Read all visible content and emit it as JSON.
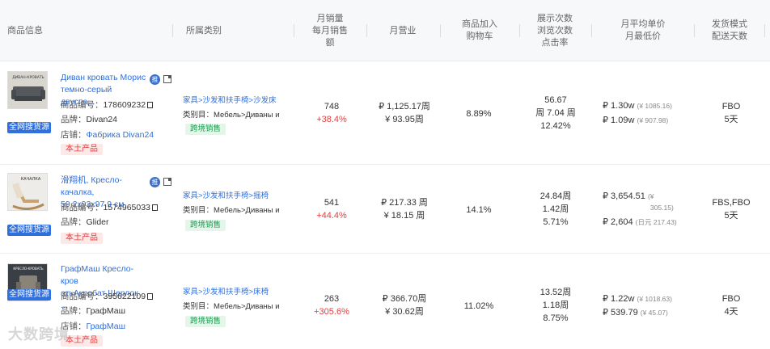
{
  "headers": {
    "product_info": "商品信息",
    "category": "所属类别",
    "monthly_sales_l1": "月销量",
    "monthly_sales_l2": "每月销售",
    "monthly_sales_l3": "额",
    "monthly_revenue": "月营业",
    "add_to_cart_l1": "商品加入",
    "add_to_cart_l2": "购物车",
    "views_l1": "展示次数",
    "views_l2": "浏览次数",
    "views_l3": "点击率",
    "price_l1": "月平均单价",
    "price_l2": "月最低价",
    "shipping_l1": "发货模式",
    "shipping_l2": "配送天数"
  },
  "labels": {
    "all_network_source": "全网搜货源",
    "code": "商品编号：",
    "brand": "品牌：",
    "store": "店铺：",
    "local_product": "本土产品",
    "category_prefix": "类别目：",
    "cross_border": "跨境销售",
    "tui": "推"
  },
  "rows": [
    {
      "thumb_text": "ДИВАН-КРОВАТЬ",
      "name_l1": "Диван кровать Морис",
      "name_l2": "темно-серый двуспа...",
      "code": "178609232",
      "brand": "Divan24",
      "store": "Фабрика Divan24",
      "category_path": "家具>沙发和扶手椅>沙发床",
      "category_sub": "Мебель>Диваны и",
      "sales": "748",
      "sales_change": "+38.4%",
      "revenue": "₽ 1,125.17周",
      "revenue_cny": "¥ 93.95周",
      "cart_rate": "8.89%",
      "views": "56.67",
      "views2": "周 7.04 周",
      "ctr": "12.42%",
      "avg_price": "₽ 1.30w",
      "avg_price_cny": "(¥ 1085.16)",
      "min_price": "₽ 1.09w",
      "min_price_cny": "(¥ 907.98)",
      "ship_mode": "FBO",
      "ship_days": "5天"
    },
    {
      "thumb_text": "КАЧАЛКА",
      "name_l1": "滑翔机, Кресло-качалка,",
      "name_l2": "59.2x93x97.9 см",
      "code": "1574965033",
      "brand": "Glider",
      "store": "",
      "category_path": "家具>沙发和扶手椅>摇椅",
      "category_sub": "Мебель>Диваны и",
      "sales": "541",
      "sales_change": "+44.4%",
      "revenue": "₽ 217.33 周",
      "revenue_cny": "¥ 18.15 周",
      "cart_rate": "14.1%",
      "views": "24.84周",
      "views2": "1.42周",
      "ctr": "5.71%",
      "avg_price": "₽ 3,654.51",
      "avg_price_cny": "(¥",
      "avg_price_cny2": "305.15)",
      "min_price": "₽ 2,604",
      "min_price_cny": "(日元 217.43)",
      "ship_mode": "FBS,FBO",
      "ship_days": "5天"
    },
    {
      "thumb_text": "КРЕСЛО-КРОВАТЬ",
      "name_l1": "ГрафМаш Кресло-кров",
      "name_l2": "атьАкробат Шерлок ...",
      "code": "395622109",
      "brand": "ГрафМаш",
      "store": "ГрафМаш",
      "category_path": "家具>沙发和扶手椅>床椅",
      "category_sub": "Мебель>Диваны и",
      "sales": "263",
      "sales_change": "+305.6%",
      "revenue": "₽ 366.70周",
      "revenue_cny": "¥ 30.62周",
      "cart_rate": "11.02%",
      "views": "13.52周",
      "views2": "1.18周",
      "ctr": "8.75%",
      "avg_price": "₽ 1.22w",
      "avg_price_cny": "(¥ 1018.63)",
      "min_price": "₽ 539.79",
      "min_price_cny": "(¥ 45.07)",
      "ship_mode": "FBO",
      "ship_days": "4天"
    }
  ],
  "watermark": "大数跨境",
  "colors": {
    "link": "#2f6fde",
    "red": "#e53e3e",
    "green": "#1e9e52",
    "header_bg": "#f7f8fa"
  }
}
